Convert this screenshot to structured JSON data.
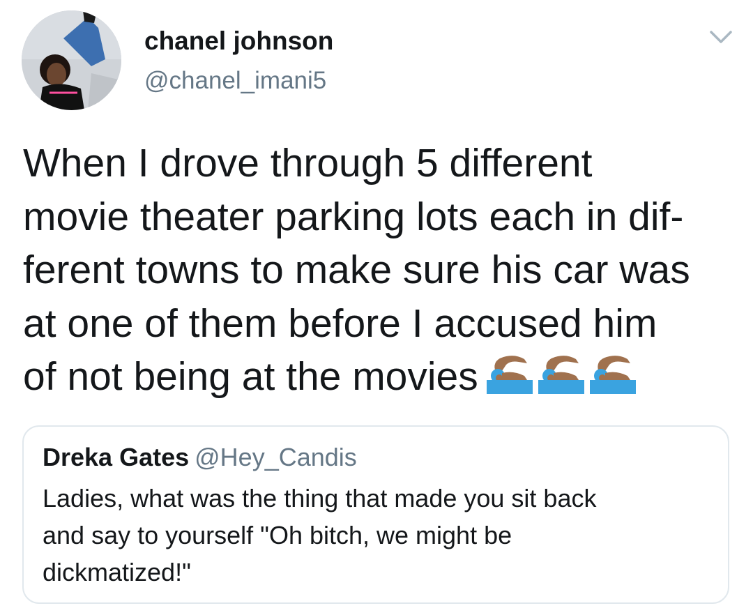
{
  "tweet": {
    "author_name": "chanel johnson",
    "author_handle": "@chanel_imani5",
    "text": "When I drove through 5 different\nmovie theater parking lots each in dif-\nferent towns to make sure his car was\nat one of them before I accused him\nof not being at the movies",
    "emojis": [
      "swimmer-emoji",
      "swimmer-emoji",
      "swimmer-emoji"
    ],
    "caret_icon": "chevron-down-icon"
  },
  "quoted_tweet": {
    "author_name": "Dreka Gates",
    "author_handle": "@Hey_Candis",
    "text": "Ladies, what was the thing that made you sit back\nand say to yourself \"Oh bitch, we might be\ndickmatized!\""
  },
  "colors": {
    "text": "#14171a",
    "secondary_text": "#657786",
    "border": "#e1e8ed",
    "swimmer_skin": "#a0714e",
    "water": "#3aa3e0"
  }
}
